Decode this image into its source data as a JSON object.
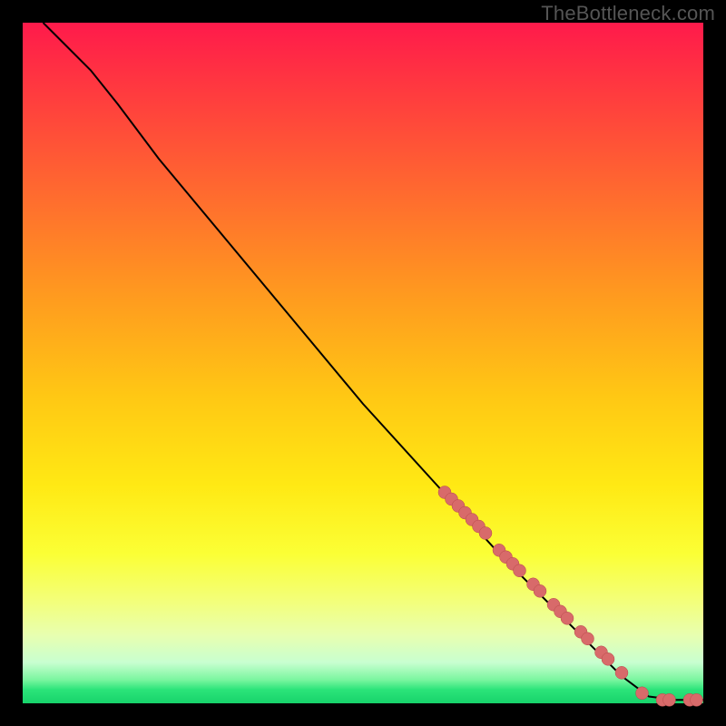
{
  "watermark": "TheBottleneck.com",
  "chart_data": {
    "type": "line",
    "title": "",
    "xlabel": "",
    "ylabel": "",
    "xlim": [
      0,
      100
    ],
    "ylim": [
      0,
      100
    ],
    "background_gradient": {
      "top": "#ff1a4b",
      "bottom": "#17d36b",
      "meaning": "red-high to green-low"
    },
    "curve": [
      {
        "x": 3,
        "y": 100
      },
      {
        "x": 6,
        "y": 97
      },
      {
        "x": 10,
        "y": 93
      },
      {
        "x": 14,
        "y": 88
      },
      {
        "x": 20,
        "y": 80
      },
      {
        "x": 30,
        "y": 68
      },
      {
        "x": 40,
        "y": 56
      },
      {
        "x": 50,
        "y": 44
      },
      {
        "x": 60,
        "y": 33
      },
      {
        "x": 70,
        "y": 22
      },
      {
        "x": 80,
        "y": 12
      },
      {
        "x": 88,
        "y": 4
      },
      {
        "x": 92,
        "y": 1
      },
      {
        "x": 96,
        "y": 0.5
      },
      {
        "x": 100,
        "y": 0.5
      }
    ],
    "points": [
      {
        "x": 62,
        "y": 31
      },
      {
        "x": 63,
        "y": 30
      },
      {
        "x": 64,
        "y": 29
      },
      {
        "x": 65,
        "y": 28
      },
      {
        "x": 66,
        "y": 27
      },
      {
        "x": 67,
        "y": 26
      },
      {
        "x": 68,
        "y": 25
      },
      {
        "x": 70,
        "y": 22.5
      },
      {
        "x": 71,
        "y": 21.5
      },
      {
        "x": 72,
        "y": 20.5
      },
      {
        "x": 73,
        "y": 19.5
      },
      {
        "x": 75,
        "y": 17.5
      },
      {
        "x": 76,
        "y": 16.5
      },
      {
        "x": 78,
        "y": 14.5
      },
      {
        "x": 79,
        "y": 13.5
      },
      {
        "x": 80,
        "y": 12.5
      },
      {
        "x": 82,
        "y": 10.5
      },
      {
        "x": 83,
        "y": 9.5
      },
      {
        "x": 85,
        "y": 7.5
      },
      {
        "x": 86,
        "y": 6.5
      },
      {
        "x": 88,
        "y": 4.5
      },
      {
        "x": 91,
        "y": 1.5
      },
      {
        "x": 94,
        "y": 0.5
      },
      {
        "x": 95,
        "y": 0.5
      },
      {
        "x": 98,
        "y": 0.5
      },
      {
        "x": 99,
        "y": 0.5
      }
    ],
    "dot_color": "#d86a6a",
    "line_color": "#000000"
  }
}
